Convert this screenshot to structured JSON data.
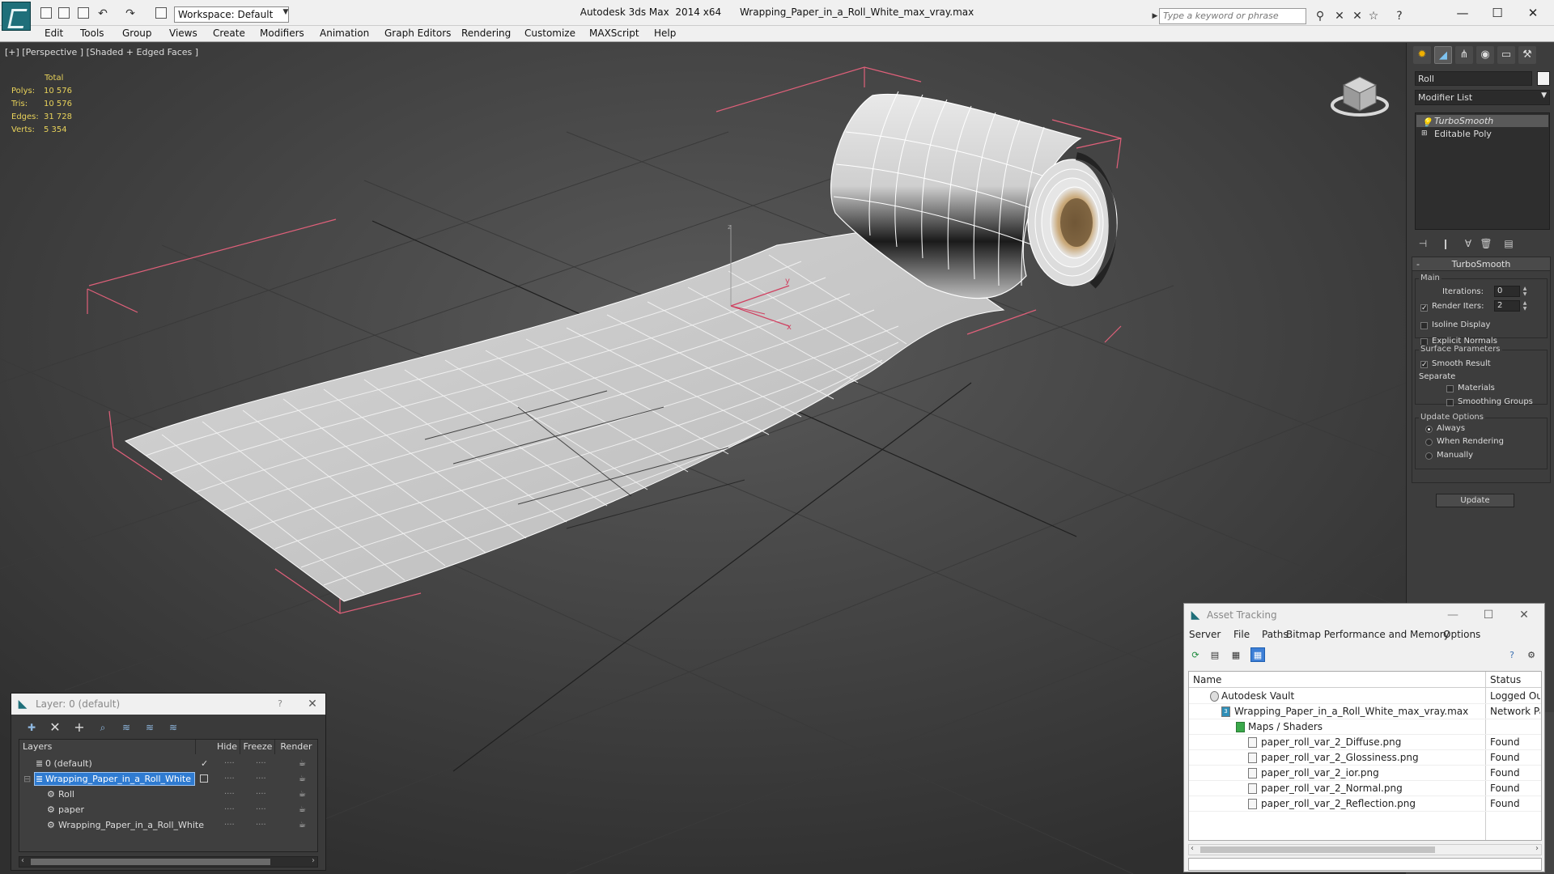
{
  "titlebar": {
    "workspace": "Workspace: Default",
    "app_title": "Autodesk 3ds Max  2014 x64",
    "file_title": "Wrapping_Paper_in_a_Roll_White_max_vray.max",
    "search_placeholder": "Type a keyword or phrase"
  },
  "menu": [
    "Edit",
    "Tools",
    "Group",
    "Views",
    "Create",
    "Modifiers",
    "Animation",
    "Graph Editors",
    "Rendering",
    "Customize",
    "MAXScript",
    "Help"
  ],
  "viewport": {
    "label": "[+] [Perspective ] [Shaded + Edged Faces ]",
    "stats": {
      "total_label": "Total",
      "polys_label": "Polys:",
      "polys": "10 576",
      "tris_label": "Tris:",
      "tris": "10 576",
      "edges_label": "Edges:",
      "edges": "31 728",
      "verts_label": "Verts:",
      "verts": "5 354"
    },
    "gizmo": {
      "y_label": "y",
      "x_label": "x",
      "z_label": "z"
    }
  },
  "command_panel": {
    "object_name": "Roll",
    "modifier_list": "Modifier List",
    "stack": [
      "TurboSmooth",
      "Editable Poly"
    ],
    "rollout_title": "TurboSmooth",
    "main_label": "Main",
    "iterations_label": "Iterations:",
    "iterations": "0",
    "render_iters_label": "Render Iters:",
    "render_iters": "2",
    "isoline_label": "Isoline Display",
    "explicit_normals_label": "Explicit Normals",
    "surface_params_label": "Surface Parameters",
    "smooth_result_label": "Smooth Result",
    "separate_label": "Separate",
    "materials_label": "Materials",
    "smoothing_groups_label": "Smoothing Groups",
    "update_options_label": "Update Options",
    "always_label": "Always",
    "when_rendering_label": "When Rendering",
    "manually_label": "Manually",
    "update_button": "Update"
  },
  "layer_window": {
    "title": "Layer: 0 (default)",
    "help": "?",
    "columns": {
      "layers": "Layers",
      "hide": "Hide",
      "freeze": "Freeze",
      "render": "Render"
    },
    "rows": [
      {
        "name": "0 (default)"
      },
      {
        "name": "Wrapping_Paper_in_a_Roll_White"
      },
      {
        "name": "Roll"
      },
      {
        "name": "paper"
      },
      {
        "name": "Wrapping_Paper_in_a_Roll_White"
      }
    ]
  },
  "asset_window": {
    "title": "Asset Tracking",
    "menu": [
      "Server",
      "File",
      "Paths",
      "Bitmap Performance and Memory",
      "Options"
    ],
    "columns": {
      "name": "Name",
      "status": "Status"
    },
    "rows": [
      {
        "name": "Autodesk Vault",
        "status": "Logged Out"
      },
      {
        "name": "Wrapping_Paper_in_a_Roll_White_max_vray.max",
        "status": "Network Pa"
      },
      {
        "name": "Maps / Shaders",
        "status": ""
      },
      {
        "name": "paper_roll_var_2_Diffuse.png",
        "status": "Found"
      },
      {
        "name": "paper_roll_var_2_Glossiness.png",
        "status": "Found"
      },
      {
        "name": "paper_roll_var_2_ior.png",
        "status": "Found"
      },
      {
        "name": "paper_roll_var_2_Normal.png",
        "status": "Found"
      },
      {
        "name": "paper_roll_var_2_Reflection.png",
        "status": "Found"
      }
    ]
  },
  "colors": {
    "viewport_bg": "#474747",
    "stats_text": "#e8d25a",
    "selection_box": "#e0607a",
    "selected_row": "#2f7bd1"
  }
}
